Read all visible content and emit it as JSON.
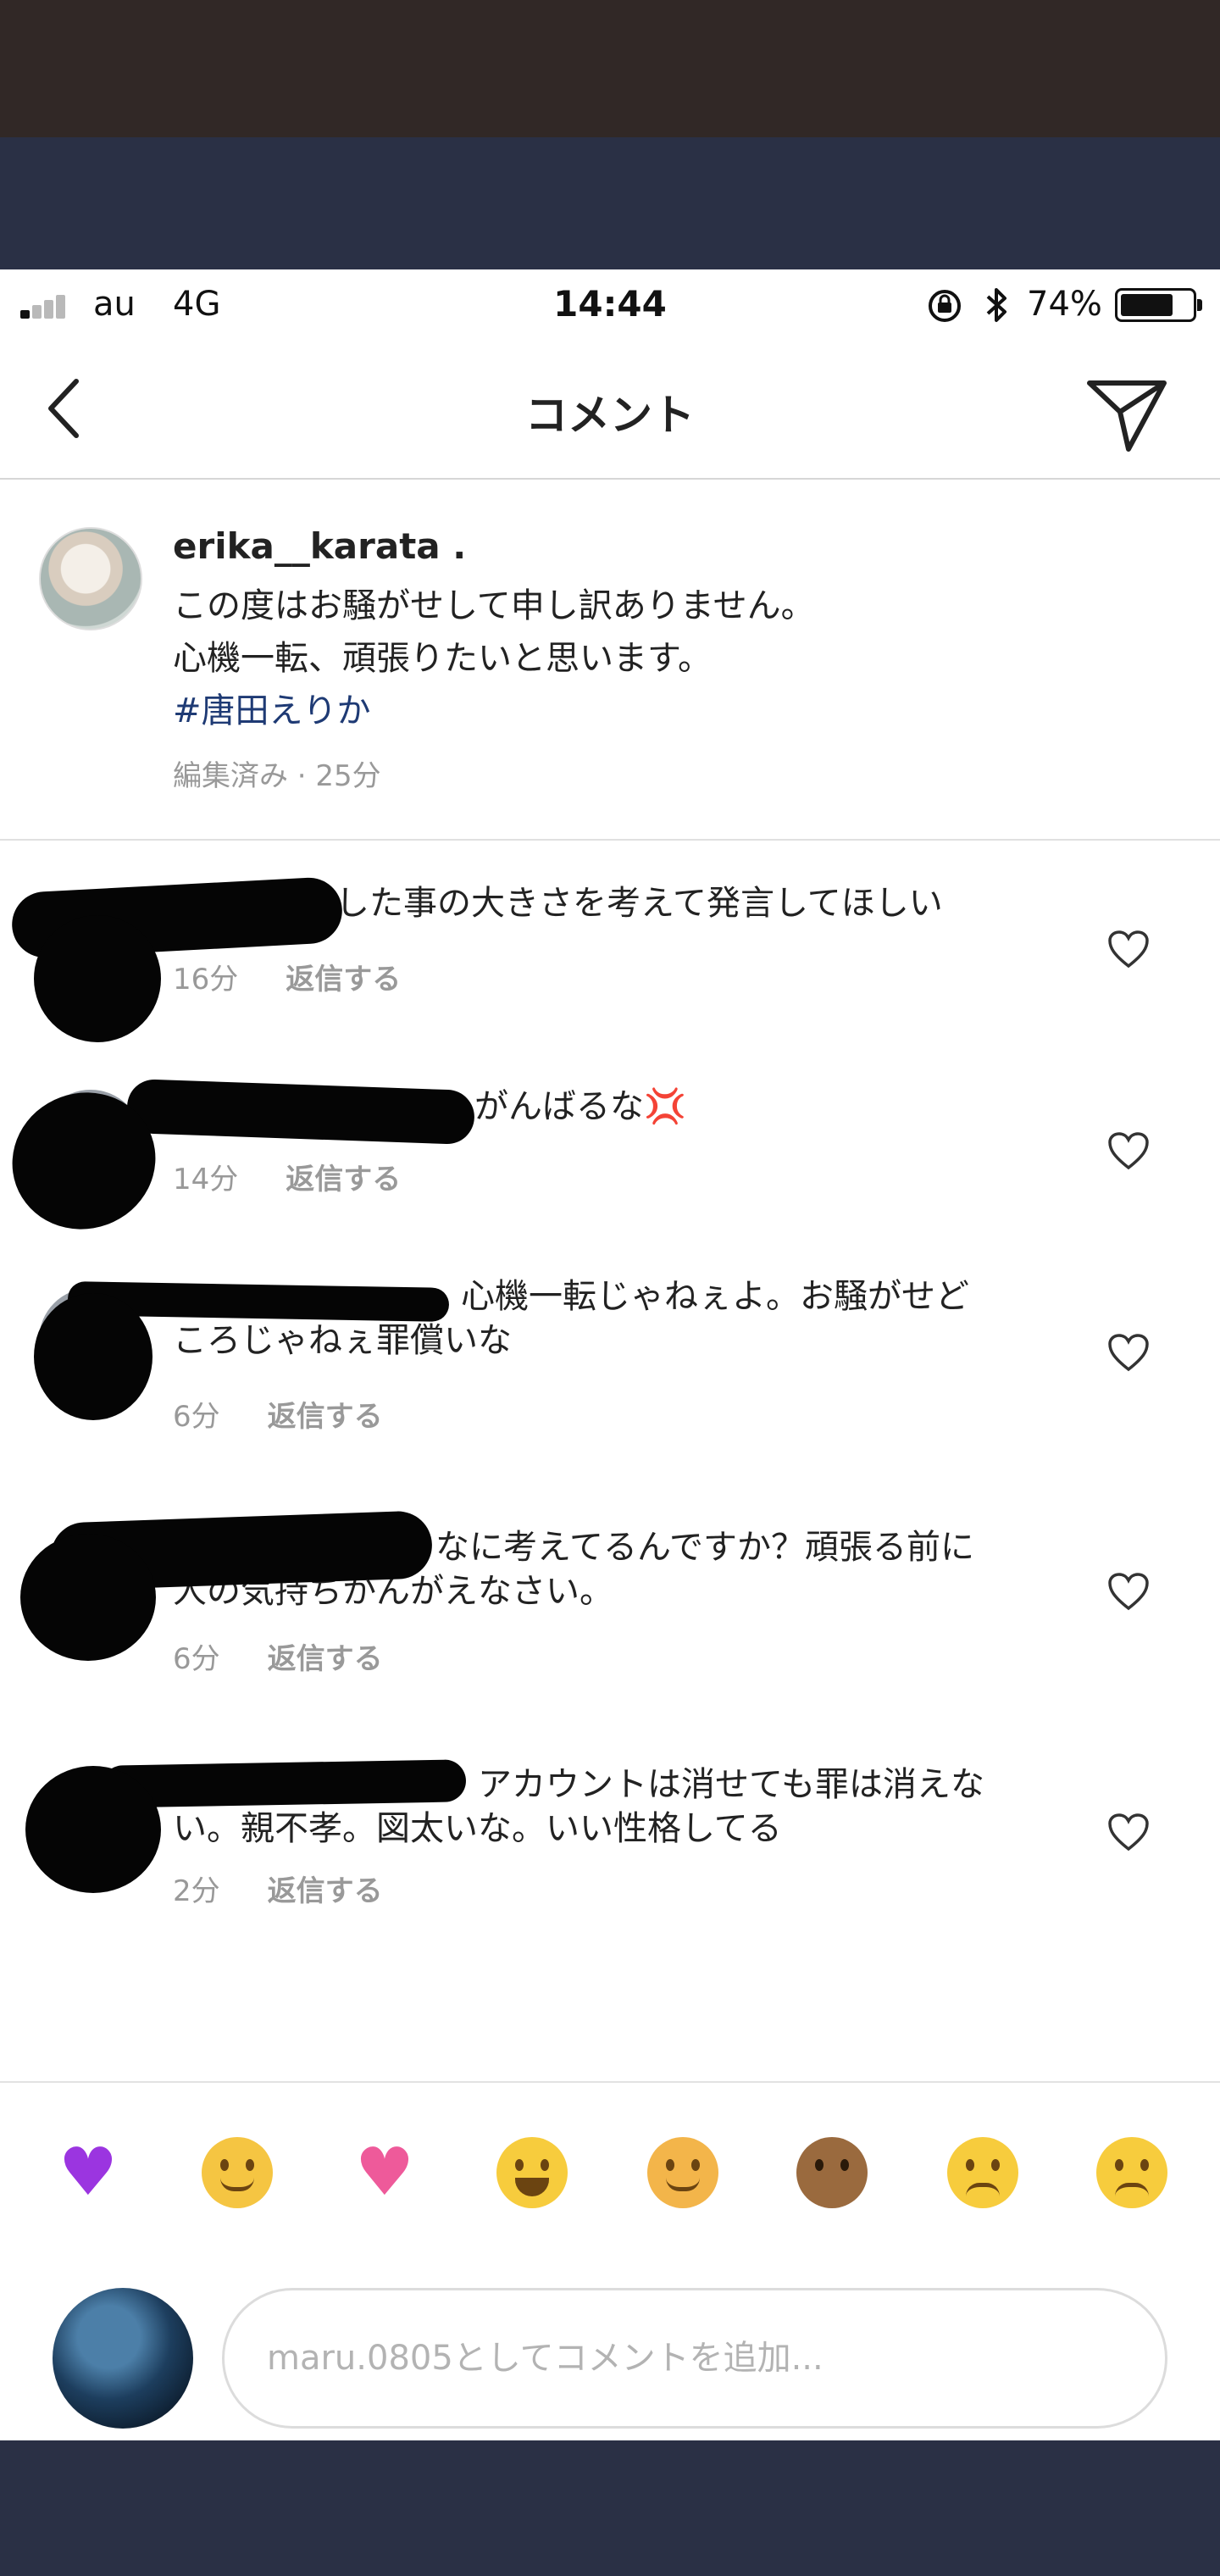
{
  "status_bar": {
    "carrier": "au",
    "network": "4G",
    "time": "14:44",
    "battery": "74%",
    "battery_level": 0.74
  },
  "header": {
    "title": "コメント"
  },
  "caption": {
    "username": "erika__karata .",
    "lines": [
      "この度はお騒がせして申し訳ありません。",
      "心機一転、頑張りたいと思います。"
    ],
    "hashtag": "#唐田えりか",
    "meta": "編集済み · 25分"
  },
  "comments": [
    {
      "text": "した事の大きさを考えて発言してほしい",
      "time": "16分",
      "reply": "返信する"
    },
    {
      "text": "がんばるな💢",
      "time": "14分",
      "reply": "返信する"
    },
    {
      "text": "心機一転じゃねぇよ。お騒がせど\nころじゃねぇ罪償いな",
      "time": "6分",
      "reply": "返信する"
    },
    {
      "text": "なに考えてるんですか？頑張る前に\n人の気持ちかんがえなさい。",
      "time": "6分",
      "reply": "返信する"
    },
    {
      "text": "アカウントは消せても罪は消えな\nい。親不孝。図太いな。いい性格してる",
      "time": "2分",
      "reply": "返信する"
    }
  ],
  "emoji_bar": [
    "purple-heart",
    "face-palm-woman",
    "pink-heart",
    "joy-face",
    "raising-hand-woman",
    "speak-no-evil-monkey",
    "crying-face",
    "triumph-face"
  ],
  "input": {
    "placeholder": "maru.0805としてコメントを追加..."
  }
}
